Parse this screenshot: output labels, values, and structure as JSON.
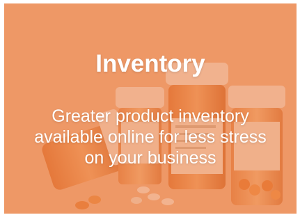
{
  "card": {
    "title": "Inventory",
    "description": "Greater product inventory available online for less stress on your business",
    "background_image": "prescription-pill-bottles-photo",
    "overlay_color": "#ec874e"
  }
}
